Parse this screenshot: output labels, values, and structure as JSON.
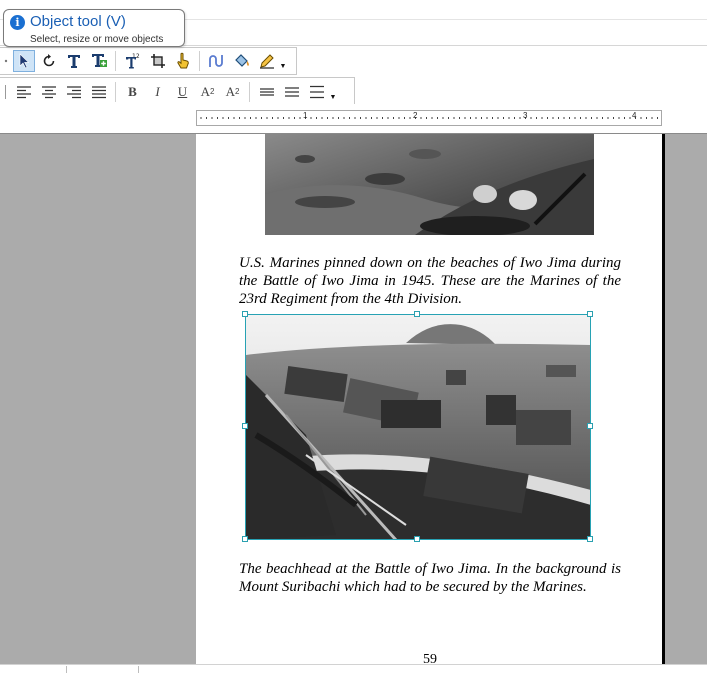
{
  "tooltip": {
    "title": "Object tool (V)",
    "description": "Select, resize or move objects",
    "icon": "info-icon"
  },
  "toolbar_top": {
    "buttons": [
      {
        "name": "object-tool",
        "icon": "arrow-pointer-icon",
        "active": true
      },
      {
        "name": "rotate-tool",
        "icon": "rotate-icon"
      },
      {
        "name": "text-tool",
        "icon": "text-t-icon"
      },
      {
        "name": "text-frame-tool",
        "icon": "text-frame-icon"
      },
      {
        "name": "numbering-tool",
        "icon": "numbered-text-icon"
      },
      {
        "name": "crop-tool",
        "icon": "crop-icon"
      },
      {
        "name": "link-tool",
        "icon": "hand-link-icon"
      },
      {
        "name": "connector-tool",
        "icon": "connector-icon"
      },
      {
        "name": "fill-tool",
        "icon": "paint-bucket-icon"
      },
      {
        "name": "pen-tool",
        "icon": "pencil-icon"
      }
    ]
  },
  "toolbar_format": {
    "bold": "B",
    "italic": "I",
    "underline": "U",
    "superscript": "A",
    "superscript_mark": "2",
    "subscript": "A",
    "subscript_mark": "2"
  },
  "ruler": {
    "marks": [
      "1",
      "2",
      "3",
      "4"
    ]
  },
  "document": {
    "caption1": "U.S. Marines pinned down on the beaches of Iwo Jima during the Battle of Iwo Jima in 1945. These are the Marines of the 23rd Regiment from the 4th Division.",
    "caption2": "The beachhead at the Battle of Iwo Jima. In the background is Mount Suribachi which had to be secured by the Marines.",
    "page_number": "59"
  },
  "colors": {
    "accent": "#1a6fd1",
    "selection": "#27a2b4",
    "workspace": "#ababab"
  }
}
